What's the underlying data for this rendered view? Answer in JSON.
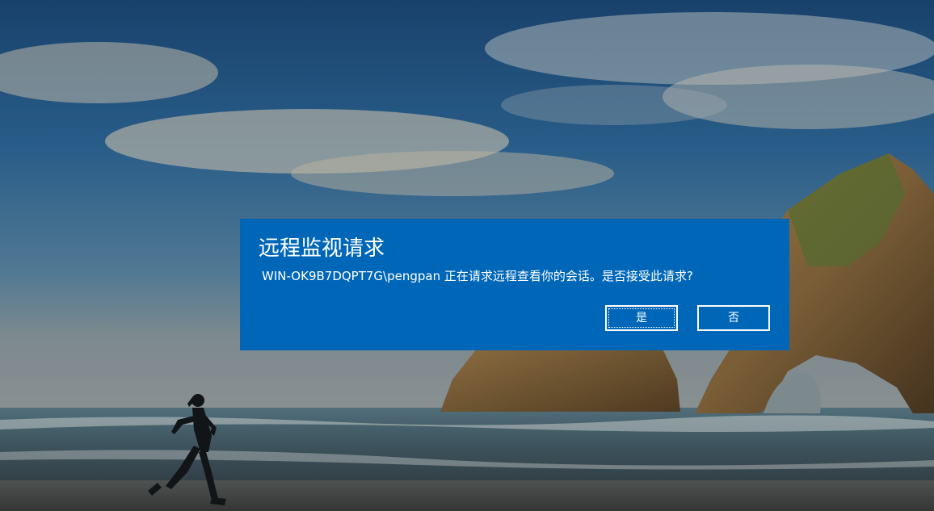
{
  "dialog": {
    "title": "远程监视请求",
    "message": "WIN-OK9B7DQPT7G\\pengpan 正在请求远程查看你的会话。是否接受此请求?",
    "yes_label": "是",
    "no_label": "否"
  },
  "colors": {
    "dialog_background": "#0067b8",
    "dialog_text": "#ffffff",
    "button_border": "#ffffff"
  },
  "icons": {
    "wallpaper": "beach-runner-rock-arch-wallpaper"
  }
}
